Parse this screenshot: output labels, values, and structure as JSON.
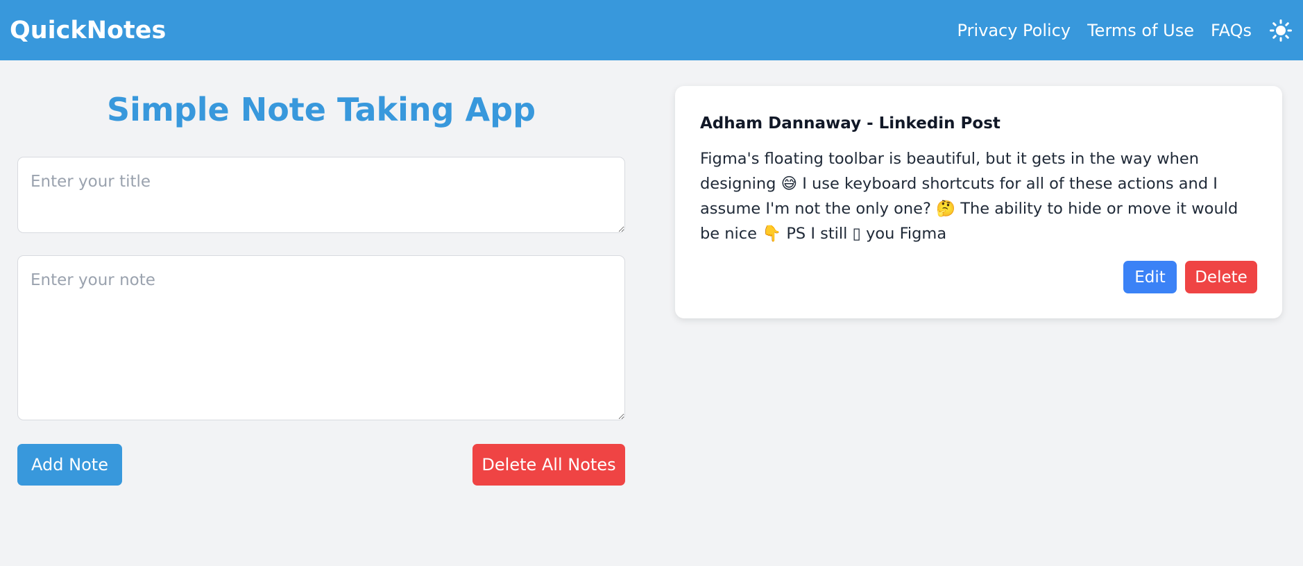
{
  "navbar": {
    "brand": "QuickNotes",
    "links": [
      "Privacy Policy",
      "Terms of Use",
      "FAQs"
    ],
    "theme_icon": "sun-icon"
  },
  "main": {
    "title": "Simple Note Taking App",
    "title_placeholder": "Enter your title",
    "note_placeholder": "Enter your note",
    "add_label": "Add Note",
    "delete_all_label": "Delete All Notes"
  },
  "notes": [
    {
      "title": "Adham Dannaway - Linkedin Post",
      "body": "Figma's floating toolbar is beautiful, but it gets in the way when designing 😅 I use keyboard shortcuts for all of these actions and I assume I'm not the only one? 🤔 The ability to hide or move it would be nice 👇 PS I still ▯ you Figma",
      "edit_label": "Edit",
      "delete_label": "Delete"
    }
  ],
  "colors": {
    "primary": "#3898dc",
    "danger": "#ef4444",
    "edit": "#3b82f6",
    "background": "#f2f3f5"
  }
}
